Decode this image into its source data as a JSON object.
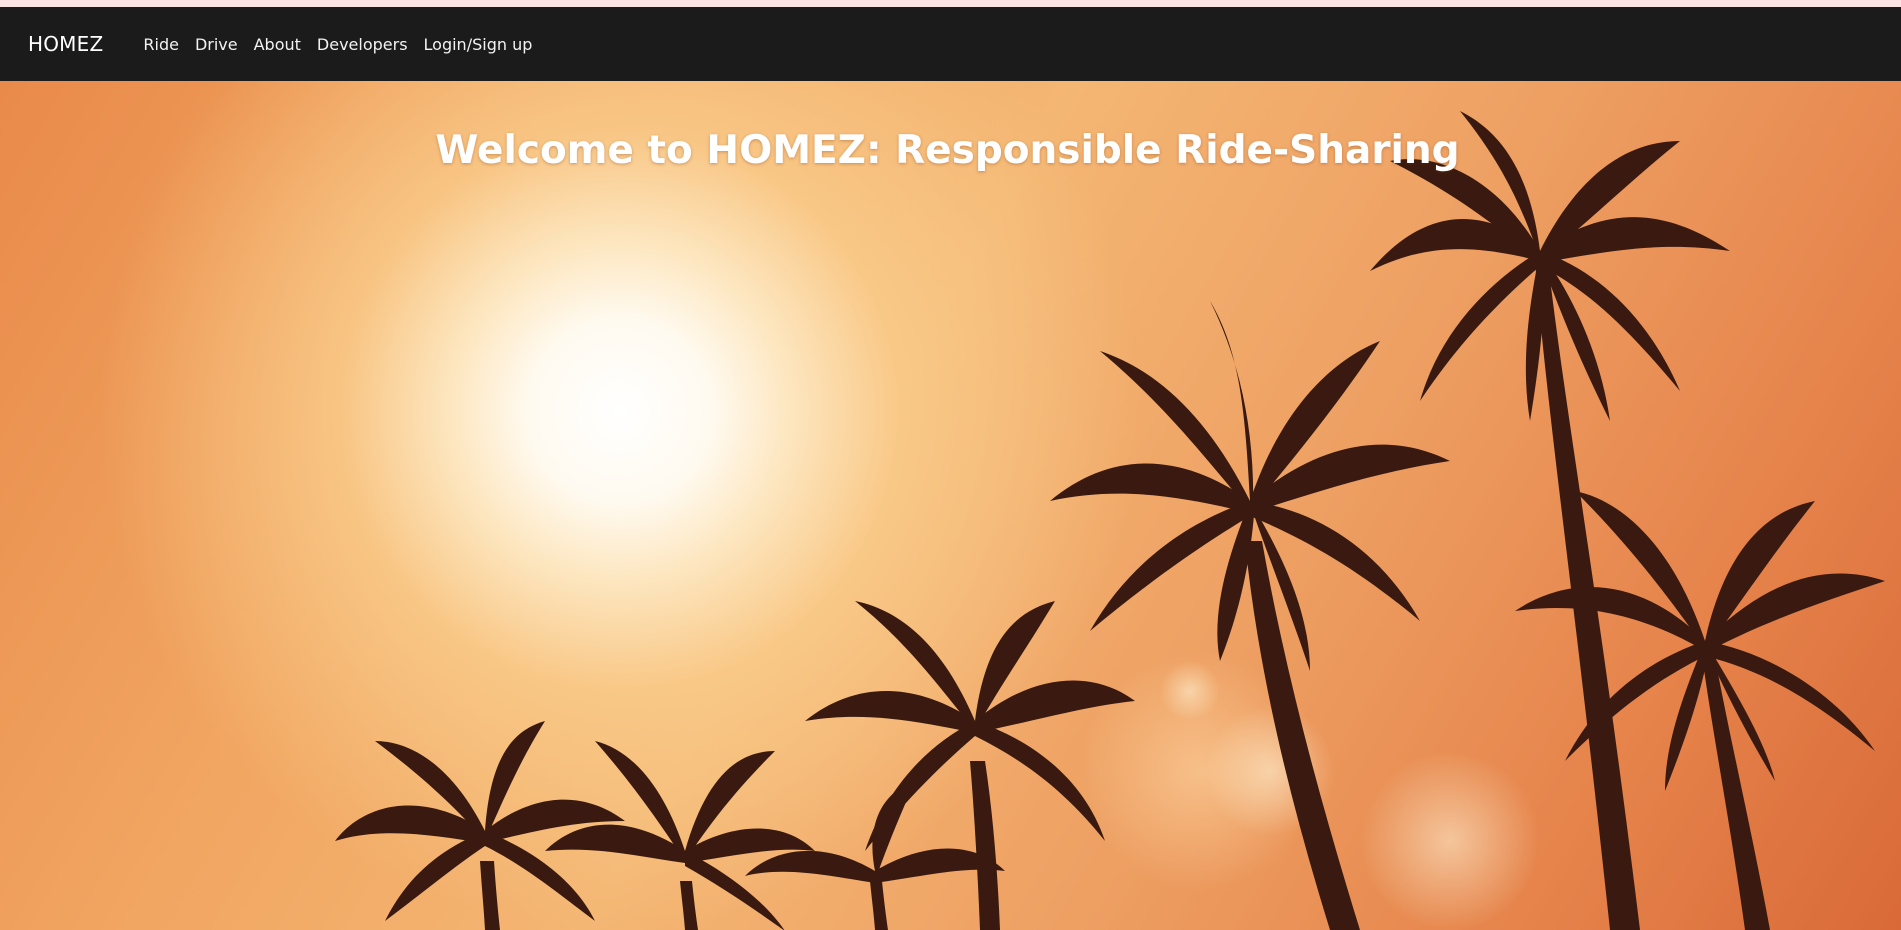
{
  "navbar": {
    "brand": "HOMEZ",
    "links": [
      {
        "label": "Ride"
      },
      {
        "label": "Drive"
      },
      {
        "label": "About"
      },
      {
        "label": "Developers"
      },
      {
        "label": "Login/Sign up"
      }
    ]
  },
  "hero": {
    "title": "Welcome to HOMEZ: Responsible Ride-Sharing",
    "background_image": "sunset palm trees silhouette"
  },
  "colors": {
    "navbar_bg": "#1b1b1b",
    "nav_text": "#ffffff",
    "sky_orange": "#f1a561",
    "palm_silhouette": "#3a1a10"
  }
}
